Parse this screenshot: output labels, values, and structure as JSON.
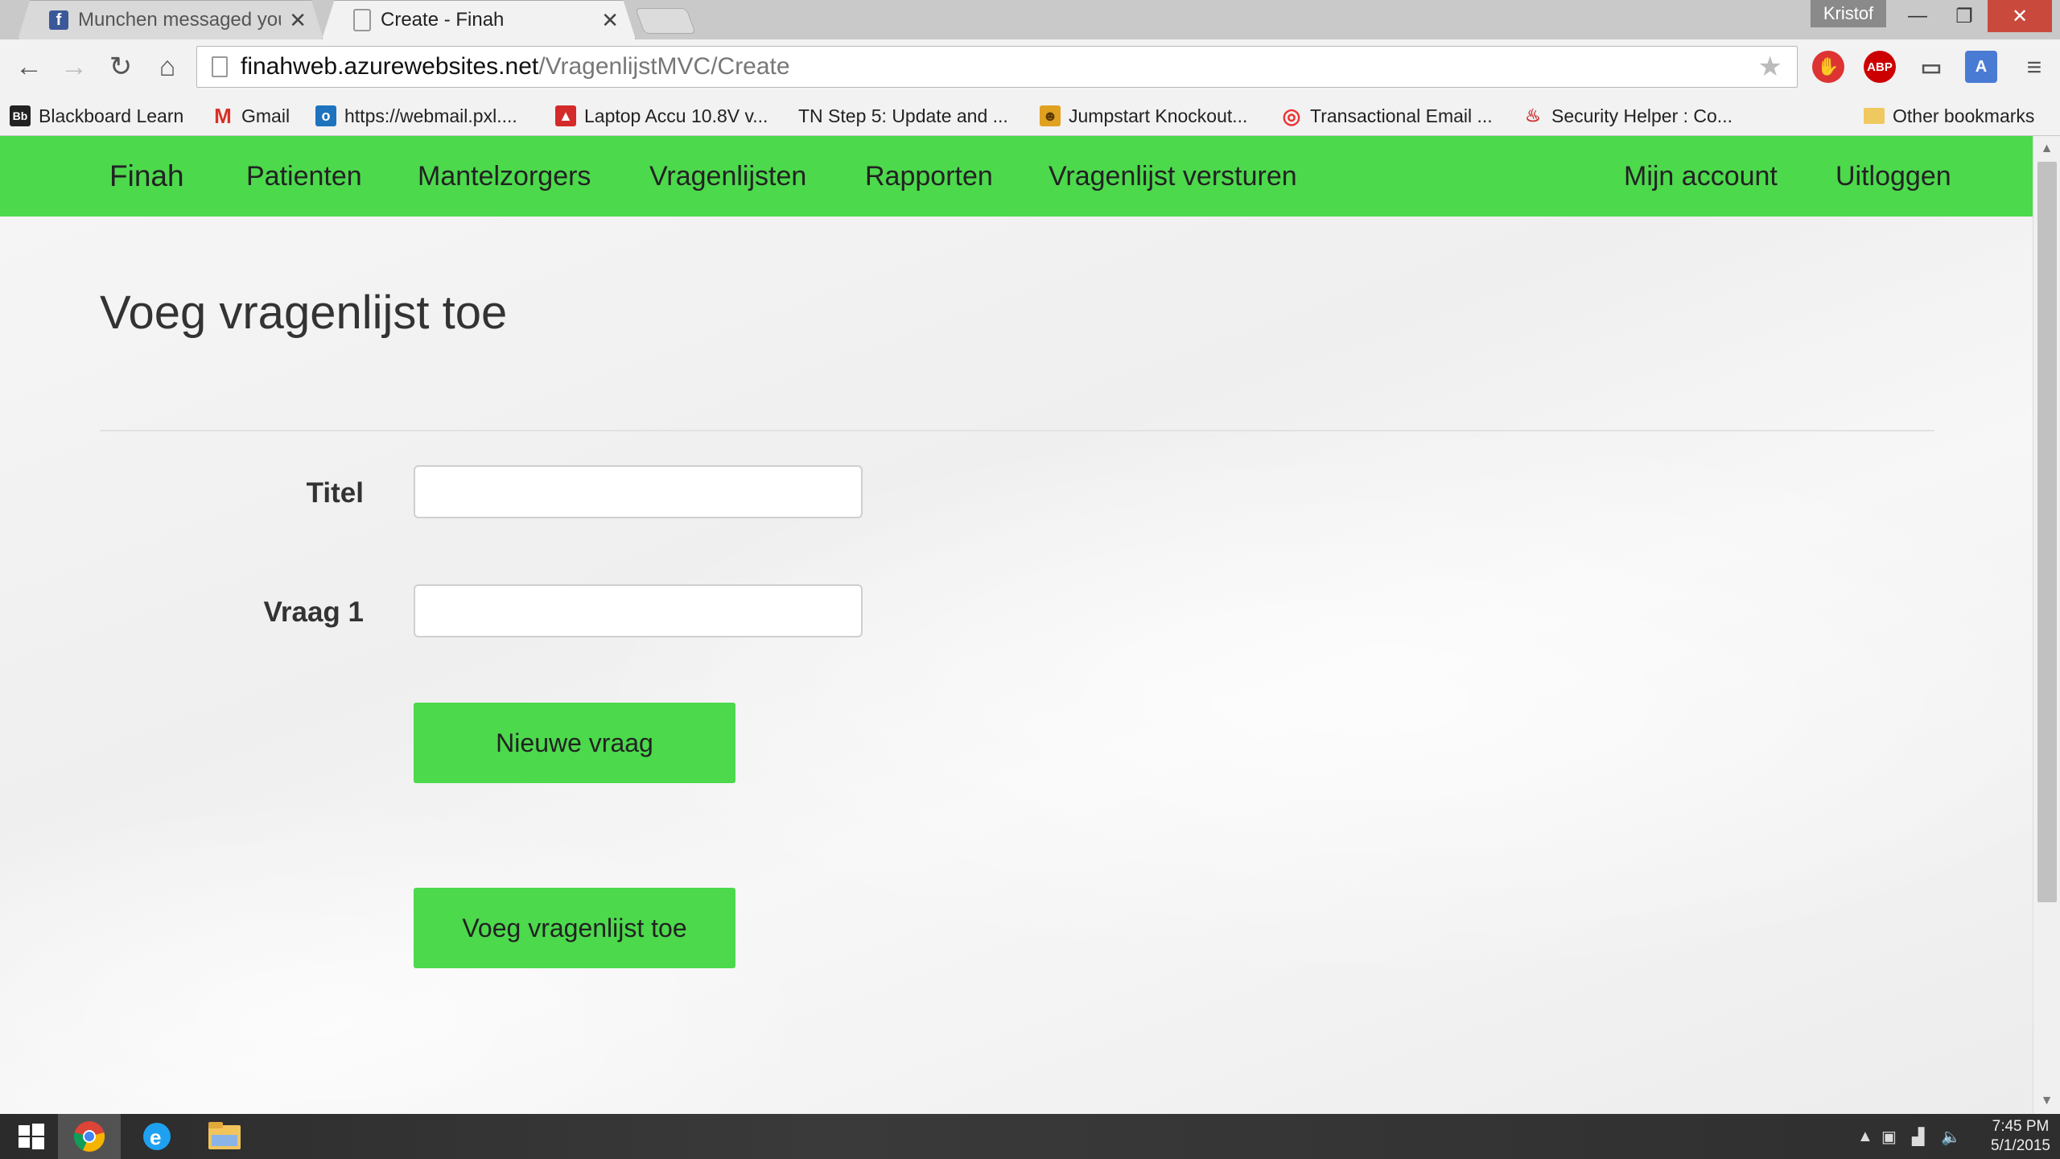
{
  "browser": {
    "tabs": [
      {
        "title": "Munchen messaged you",
        "favicon": "facebook-icon",
        "active": false
      },
      {
        "title": "Create - Finah",
        "favicon": "page-icon",
        "active": true
      }
    ],
    "profile_name": "Kristof",
    "url_host": "finahweb.azurewebsites.net",
    "url_path": "/VragenlijstMVC/Create",
    "extensions": {
      "abp_label": "ABP"
    },
    "bookmarks": [
      {
        "label": "Blackboard Learn",
        "icon": "blackboard-icon"
      },
      {
        "label": "Gmail",
        "icon": "gmail-icon"
      },
      {
        "label": "https://webmail.pxl....",
        "icon": "outlook-icon"
      },
      {
        "label": "Laptop Accu 10.8V v...",
        "icon": "shop-icon"
      },
      {
        "label": "TN Step 5: Update and ...",
        "icon": "tn-icon"
      },
      {
        "label": "Jumpstart Knockout...",
        "icon": "knockout-icon"
      },
      {
        "label": "Transactional Email ...",
        "icon": "email-target-icon"
      },
      {
        "label": "Security Helper : Co...",
        "icon": "java-icon"
      }
    ],
    "other_bookmarks": "Other bookmarks"
  },
  "app": {
    "nav": {
      "brand": "Finah",
      "items": [
        "Patienten",
        "Mantelzorgers",
        "Vragenlijsten",
        "Rapporten",
        "Vragenlijst versturen"
      ],
      "right_items": [
        "Mijn account",
        "Uitloggen"
      ]
    },
    "page_title": "Voeg vragenlijst toe",
    "form": {
      "fields": [
        {
          "label": "Titel",
          "value": ""
        },
        {
          "label": "Vraag 1",
          "value": ""
        }
      ],
      "new_question_button": "Nieuwe vraag",
      "submit_button": "Voeg vragenlijst toe"
    },
    "accent_color": "#4cd94c"
  },
  "taskbar": {
    "time": "7:45 PM",
    "date": "5/1/2015"
  }
}
